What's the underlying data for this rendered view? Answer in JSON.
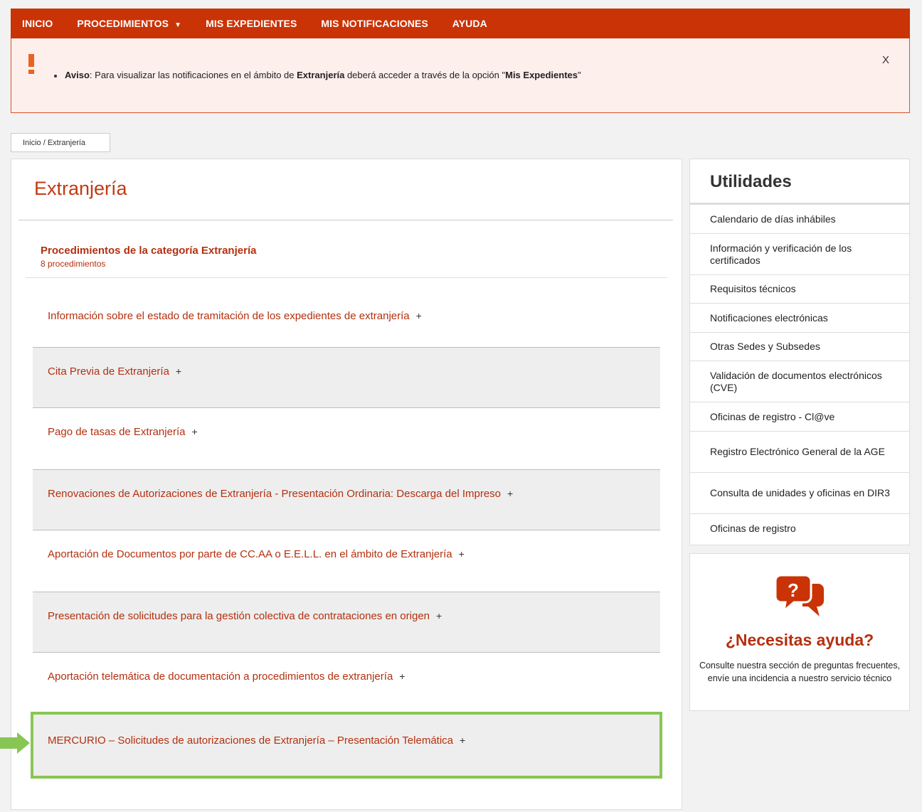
{
  "nav": {
    "items": [
      "INICIO",
      "PROCEDIMIENTOS",
      "MIS EXPEDIENTES",
      "MIS NOTIFICACIONES",
      "AYUDA"
    ],
    "dropdown_icon": "caret-down-icon"
  },
  "alert": {
    "icon": "exclamation-icon",
    "label": "Aviso",
    "text_before": ": Para visualizar las notificaciones en el ámbito de ",
    "bold_word": "Extranjería",
    "text_middle": " deberá acceder a través de la opción \"",
    "option": "Mis Expedientes",
    "text_end": "\"",
    "close": "X"
  },
  "breadcrumb": "Inicio / Extranjería",
  "main": {
    "title": "Extranjería",
    "category_title": "Procedimientos de la categoría Extranjería",
    "category_count": "8 procedimientos",
    "procedures": [
      "Información sobre el estado de tramitación de los expedientes de extranjería",
      "Cita Previa de Extranjería",
      "Pago de tasas de Extranjería",
      "Renovaciones de Autorizaciones de Extranjería - Presentación Ordinaria: Descarga del Impreso",
      "Aportación de Documentos por parte de CC.AA o E.E.L.L. en el ámbito de Extranjería",
      "Presentación de solicitudes para la gestión colectiva de contrataciones en origen",
      "Aportación telemática de documentación a procedimientos de extranjería",
      "MERCURIO – Solicitudes de autorizaciones de Extranjería – Presentación Telemática"
    ],
    "plus": "+"
  },
  "sidebar": {
    "title": "Utilidades",
    "items": [
      "Calendario de días inhábiles",
      "Información y verificación de los certificados",
      "Requisitos técnicos",
      "Notificaciones electrónicas",
      "Otras Sedes y Subsedes",
      "Validación de documentos electrónicos (CVE)",
      "Oficinas de registro - Cl@ve",
      "Registro Electrónico General de la AGE",
      "Consulta de unidades y oficinas en DIR3",
      "Oficinas de registro"
    ]
  },
  "help": {
    "icon": "help-chat-icon",
    "title": "¿Necesitas ayuda?",
    "text": "Consulte nuestra sección de preguntas frecuentes, envíe una incidencia a nuestro servicio técnico"
  },
  "colors": {
    "brand": "#c93306",
    "link": "#b4300f",
    "highlight": "#88c653"
  }
}
